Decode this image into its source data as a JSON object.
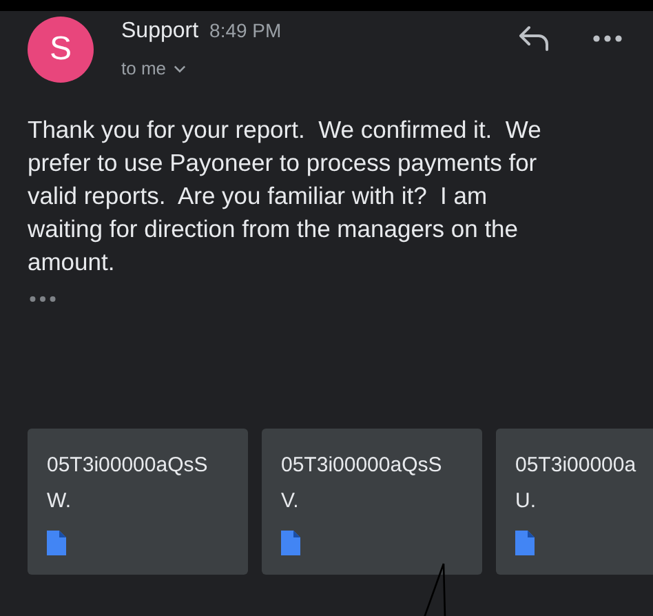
{
  "header": {
    "avatar_letter": "S",
    "sender": "Support",
    "time": "8:49 PM",
    "recipient": "to me"
  },
  "body": "Thank you for your report.  We confirmed it.  We\nprefer to use Payoneer to process payments for\nvalid reports.  Are you familiar with it?  I am\nwaiting for direction from the managers on the\namount.",
  "attachments": [
    {
      "name": "05T3i00000aQsS",
      "suffix": "W."
    },
    {
      "name": "05T3i00000aQsS",
      "suffix": "V."
    },
    {
      "name": "05T3i00000a",
      "suffix": "U."
    }
  ]
}
